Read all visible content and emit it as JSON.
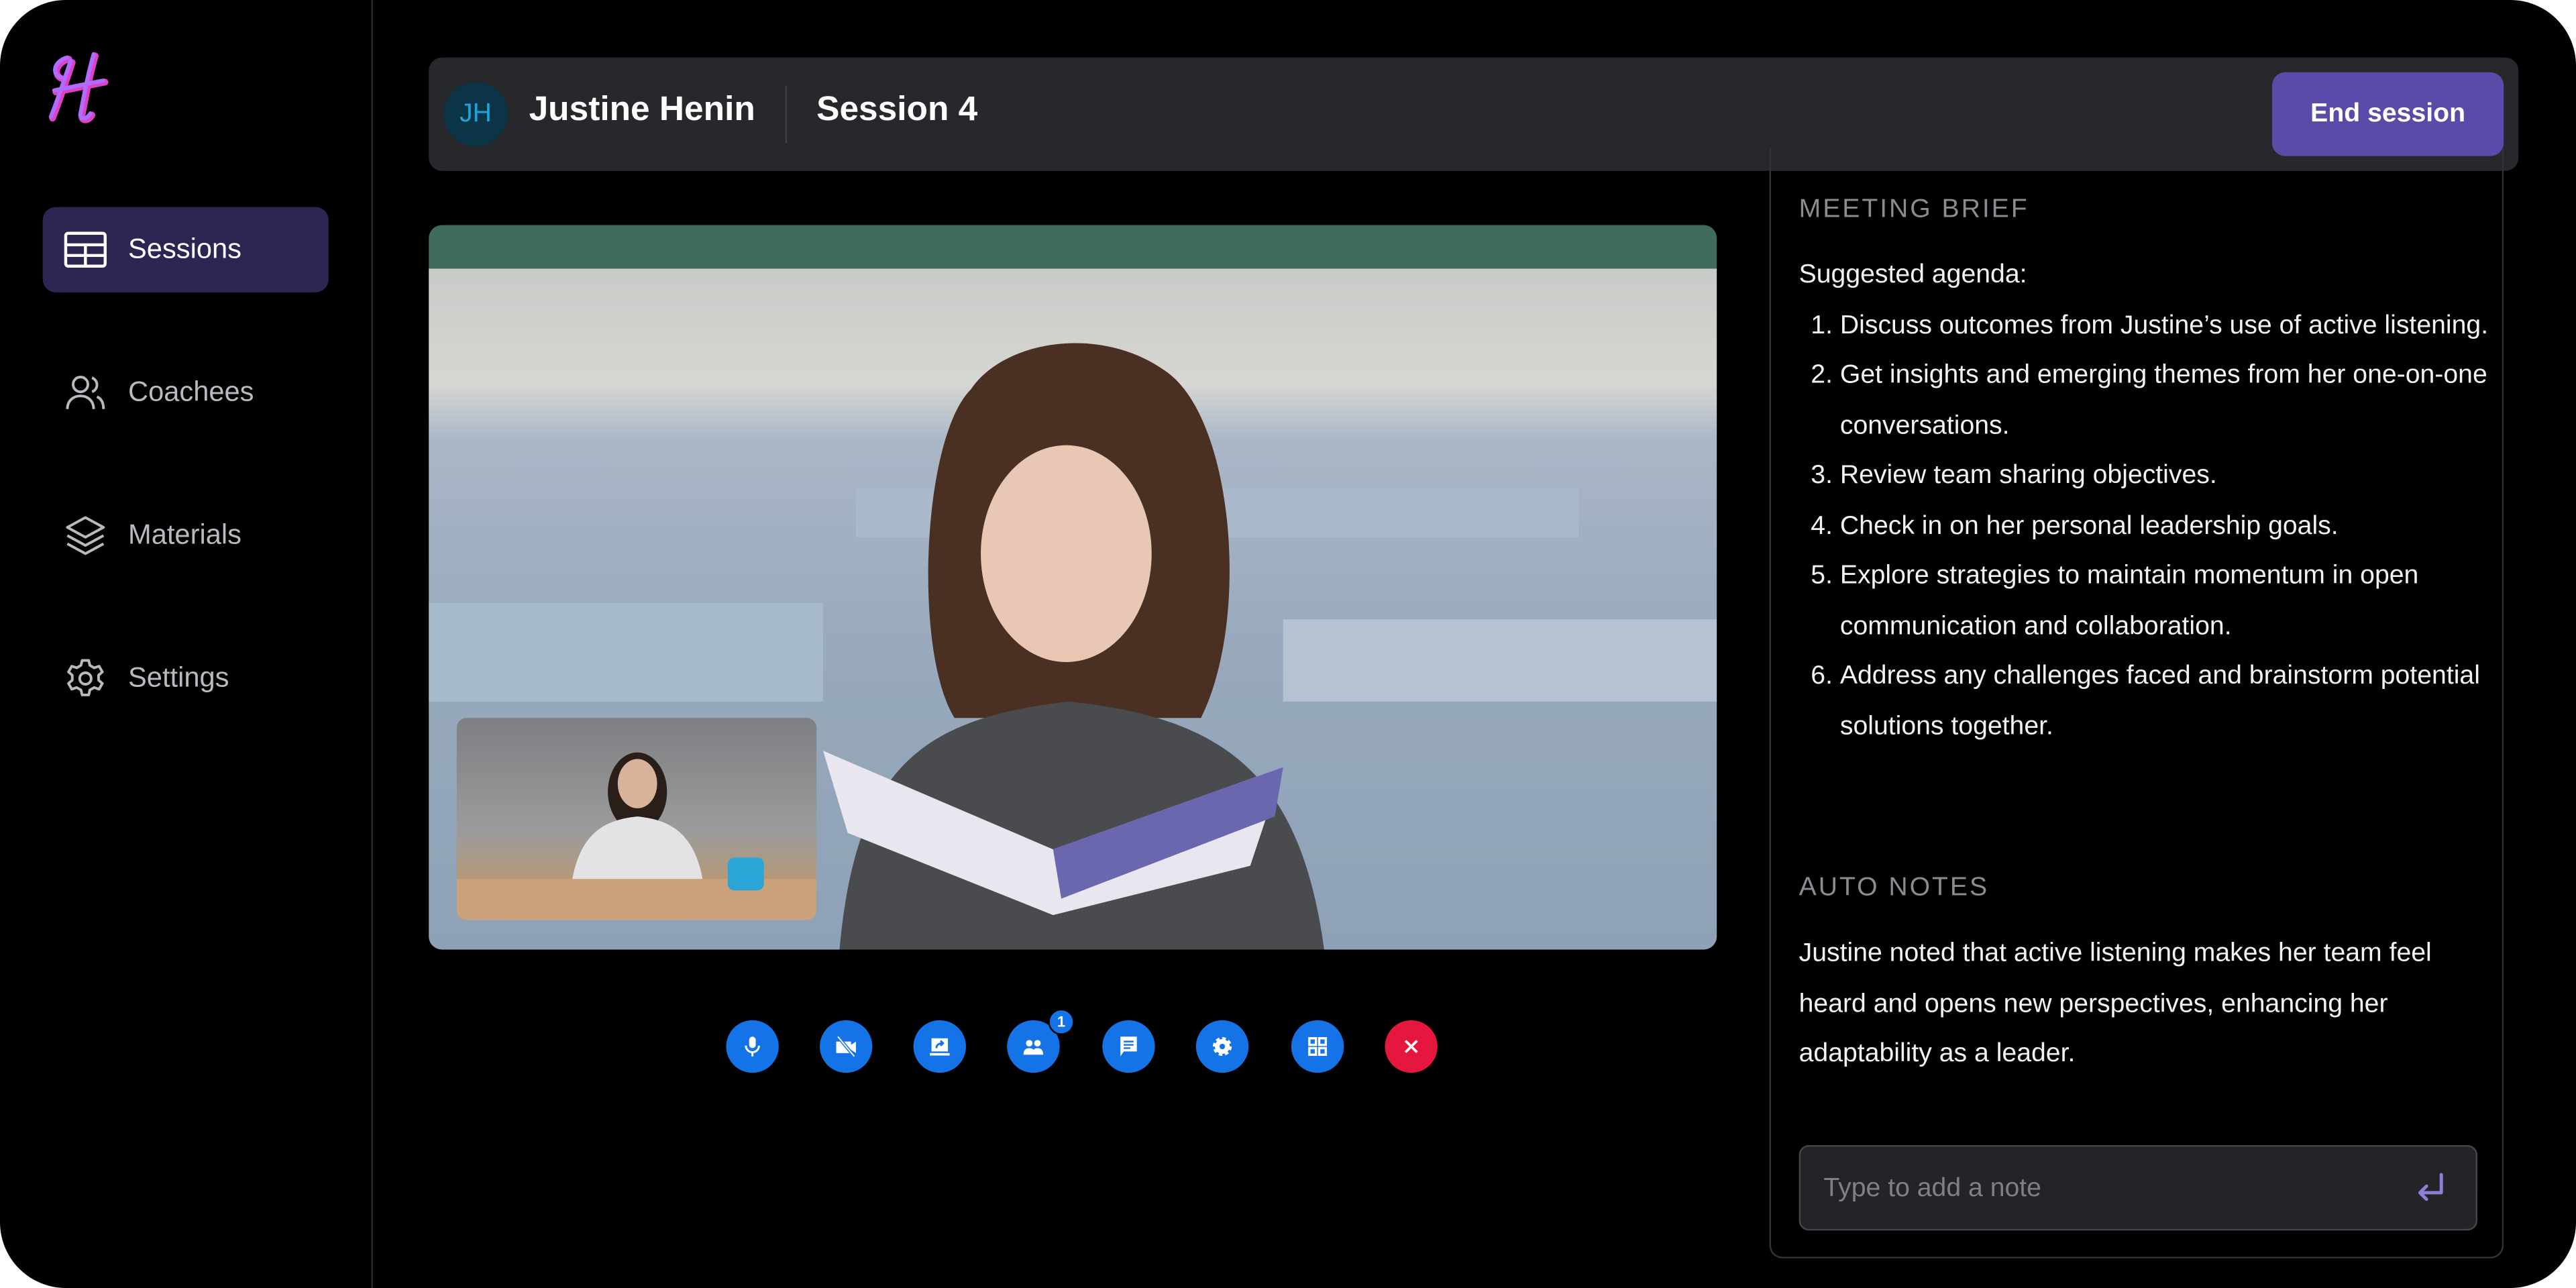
{
  "sidebar": {
    "logo": "H",
    "items": [
      {
        "label": "Sessions",
        "icon": "table-icon",
        "active": true
      },
      {
        "label": "Coachees",
        "icon": "users-icon",
        "active": false
      },
      {
        "label": "Materials",
        "icon": "layers-icon",
        "active": false
      },
      {
        "label": "Settings",
        "icon": "gear-icon",
        "active": false
      }
    ]
  },
  "header": {
    "initials": "JH",
    "name": "Justine Henin",
    "session": "Session 4",
    "end_label": "End session"
  },
  "controls": {
    "participants_badge": "1",
    "icons": [
      "mic-icon",
      "video-off-icon",
      "screen-share-icon",
      "participants-icon",
      "chat-icon",
      "settings-icon",
      "grid-view-icon",
      "leave-icon"
    ]
  },
  "brief": {
    "title": "MEETING BRIEF",
    "intro": "Suggested agenda:",
    "items": [
      "Discuss outcomes from Justine’s use of active listening.",
      "Get insights and emerging themes from her one-on-one conversations.",
      "Review team sharing objectives.",
      "Check in on her personal leadership goals.",
      "Explore strategies to maintain momentum in open communication and collaboration.",
      "Address any challenges faced and brainstorm potential solutions together."
    ]
  },
  "notes": {
    "title": "AUTO NOTES",
    "text": "Justine noted that active listening makes her team feel heard and opens new perspectives, enhancing her adaptability as a leader.",
    "placeholder": "Type to add a note"
  },
  "colors": {
    "accent": "#5b4aa8",
    "nav_active": "#2f2552",
    "control_blue": "#1473e6",
    "control_red": "#e5173f"
  }
}
